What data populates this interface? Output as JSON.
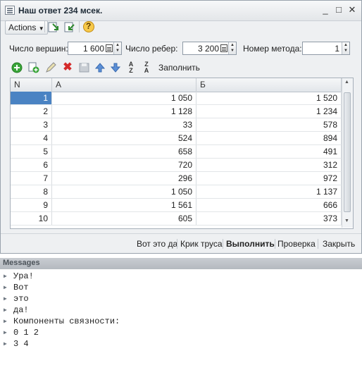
{
  "window": {
    "title": "Наш ответ 234 мсек.",
    "controls": [
      "_",
      "□",
      "✕"
    ]
  },
  "toolbar": {
    "actions_label": "Actions",
    "help_label": "?"
  },
  "params": {
    "vertices_label": "Число вершин:",
    "vertices_value": "1 600",
    "edges_label": "Число ребер:",
    "edges_value": "3 200",
    "method_label": "Номер метода:",
    "method_value": "1"
  },
  "grid_toolbar": {
    "fill_label": "Заполнить"
  },
  "table": {
    "columns": [
      "N",
      "А",
      "Б"
    ],
    "selected_row": 0,
    "rows": [
      [
        "1",
        "1 050",
        "1 520"
      ],
      [
        "2",
        "1 128",
        "1 234"
      ],
      [
        "3",
        "33",
        "578"
      ],
      [
        "4",
        "524",
        "894"
      ],
      [
        "5",
        "658",
        "491"
      ],
      [
        "6",
        "720",
        "312"
      ],
      [
        "7",
        "296",
        "972"
      ],
      [
        "8",
        "1 050",
        "1 137"
      ],
      [
        "9",
        "1 561",
        "666"
      ],
      [
        "10",
        "605",
        "373"
      ]
    ]
  },
  "buttons": {
    "vot": "Вот это да",
    "krik": "Крик труса",
    "run": "Выполнить",
    "check": "Проверка",
    "close": "Закрыть"
  },
  "messages": {
    "header": "Messages",
    "lines": [
      "Ура!",
      "Вот",
      "это",
      "да!",
      "Компоненты связности:",
      "0 1 2",
      "3 4"
    ]
  }
}
